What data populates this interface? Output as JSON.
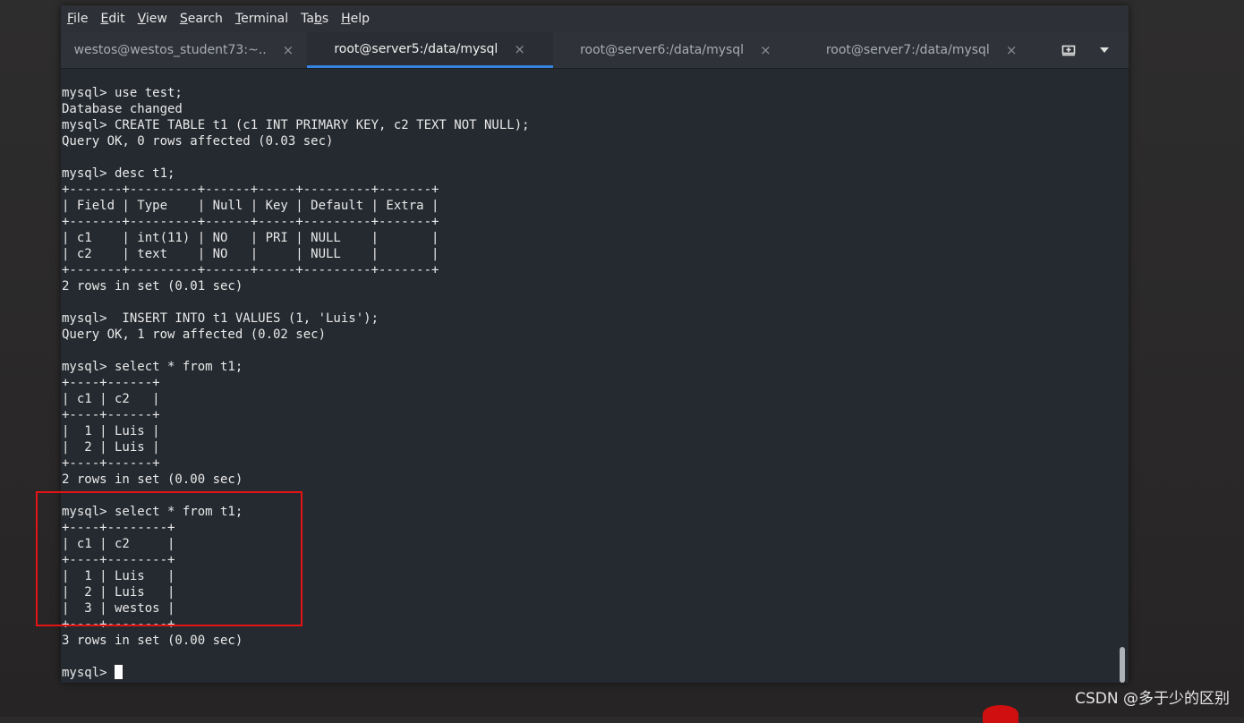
{
  "menu": {
    "items": [
      {
        "pre": "",
        "mn": "F",
        "post": "ile"
      },
      {
        "pre": "",
        "mn": "E",
        "post": "dit"
      },
      {
        "pre": "",
        "mn": "V",
        "post": "iew"
      },
      {
        "pre": "",
        "mn": "S",
        "post": "earch"
      },
      {
        "pre": "",
        "mn": "T",
        "post": "erminal"
      },
      {
        "pre": "Ta",
        "mn": "b",
        "post": "s"
      },
      {
        "pre": "",
        "mn": "H",
        "post": "elp"
      }
    ]
  },
  "tabs": [
    {
      "label": "westos@westos_student73:~...",
      "close": "×"
    },
    {
      "label": "root@server5:/data/mysql",
      "close": "×"
    },
    {
      "label": "root@server6:/data/mysql",
      "close": "×"
    },
    {
      "label": "root@server7:/data/mysql",
      "close": "×"
    }
  ],
  "toolbar": {
    "new_tab_icon": "new-tab-icon",
    "dropdown_icon": "chevron-down-icon"
  },
  "terminal": {
    "lines": [
      "mysql> use test;",
      "Database changed",
      "mysql> CREATE TABLE t1 (c1 INT PRIMARY KEY, c2 TEXT NOT NULL);",
      "Query OK, 0 rows affected (0.03 sec)",
      "",
      "mysql> desc t1;",
      "+-------+---------+------+-----+---------+-------+",
      "| Field | Type    | Null | Key | Default | Extra |",
      "+-------+---------+------+-----+---------+-------+",
      "| c1    | int(11) | NO   | PRI | NULL    |       |",
      "| c2    | text    | NO   |     | NULL    |       |",
      "+-------+---------+------+-----+---------+-------+",
      "2 rows in set (0.01 sec)",
      "",
      "mysql>  INSERT INTO t1 VALUES (1, 'Luis');",
      "Query OK, 1 row affected (0.02 sec)",
      "",
      "mysql> select * from t1;",
      "+----+------+",
      "| c1 | c2   |",
      "+----+------+",
      "|  1 | Luis |",
      "|  2 | Luis |",
      "+----+------+",
      "2 rows in set (0.00 sec)",
      "",
      "mysql> select * from t1;",
      "+----+--------+",
      "| c1 | c2     |",
      "+----+--------+",
      "|  1 | Luis   |",
      "|  2 | Luis   |",
      "|  3 | westos |",
      "+----+--------+",
      "3 rows in set (0.00 sec)",
      ""
    ],
    "prompt": "mysql> "
  },
  "watermark": "CSDN @多于少的区别",
  "colors": {
    "accent": "#3584e4",
    "highlight": "#e51414"
  }
}
